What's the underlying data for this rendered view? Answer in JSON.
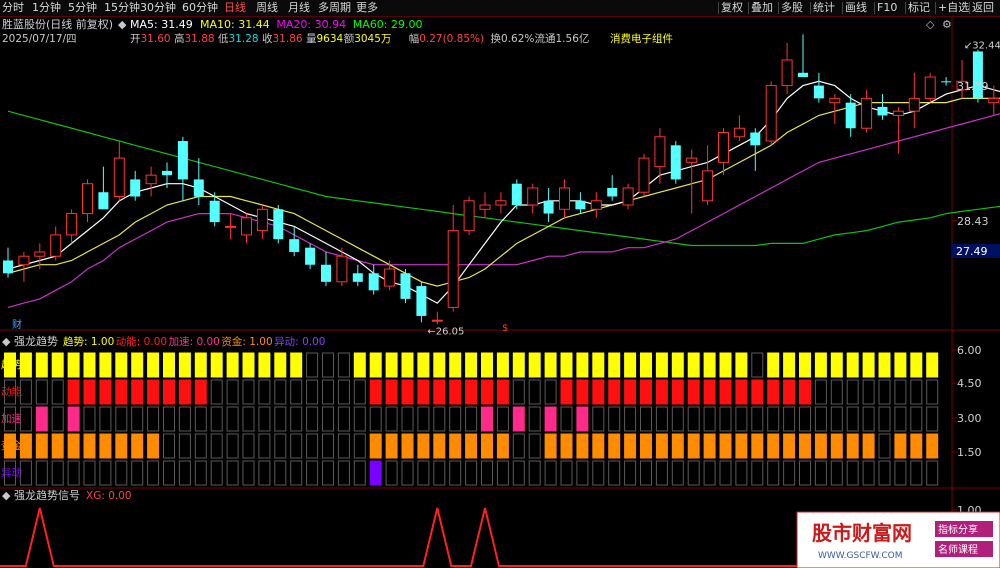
{
  "toolbar": {
    "left": [
      {
        "key": "fenshi",
        "label": "分时",
        "active": false
      },
      {
        "key": "1min",
        "label": "1分钟",
        "active": false
      },
      {
        "key": "5min",
        "label": "5分钟",
        "active": false
      },
      {
        "key": "15min",
        "label": "15分钟",
        "active": false
      },
      {
        "key": "30min",
        "label": "30分钟",
        "active": false
      },
      {
        "key": "60min",
        "label": "60分钟",
        "active": false
      },
      {
        "key": "daily",
        "label": "日线",
        "active": true
      },
      {
        "key": "weekly",
        "label": "周线",
        "active": false
      },
      {
        "key": "monthly",
        "label": "月线",
        "active": false
      },
      {
        "key": "multi",
        "label": "多周期",
        "active": false
      },
      {
        "key": "more",
        "label": "更多",
        "active": false
      }
    ],
    "right": [
      {
        "key": "fuquan",
        "label": "复权"
      },
      {
        "key": "diejia",
        "label": "叠加"
      },
      {
        "key": "duogu",
        "label": "多股"
      },
      {
        "key": "tongji",
        "label": "统计"
      },
      {
        "key": "huaxian",
        "label": "画线"
      },
      {
        "key": "f10",
        "label": "F10"
      },
      {
        "key": "biaoji",
        "label": "标记"
      },
      {
        "key": "zixuan",
        "label": "+自选"
      },
      {
        "key": "fanhui",
        "label": "返回"
      }
    ]
  },
  "header": {
    "stock": "胜蓝股份(日线 前复权)",
    "ma": [
      {
        "label": "MA5: 31.49",
        "color": "#ffffff"
      },
      {
        "label": "MA10: 31.44",
        "color": "#ffff00"
      },
      {
        "label": "MA20: 30.94",
        "color": "#ff00ff"
      },
      {
        "label": "MA60: 29.00",
        "color": "#00ff00"
      }
    ],
    "info": [
      {
        "text": "2025/07/17/四",
        "color": "#c8c8c8"
      },
      {
        "text": "开",
        "color": "#c8c8c8"
      },
      {
        "text": "31.60",
        "color": "#ff4040"
      },
      {
        "text": "高",
        "color": "#c8c8c8"
      },
      {
        "text": "31.88",
        "color": "#ff4040"
      },
      {
        "text": "低",
        "color": "#c8c8c8"
      },
      {
        "text": "31.28",
        "color": "#00e0e0"
      },
      {
        "text": "收",
        "color": "#c8c8c8"
      },
      {
        "text": "31.86",
        "color": "#ff4040"
      },
      {
        "text": "量",
        "color": "#c8c8c8"
      },
      {
        "text": "9634",
        "color": "#ffff00"
      },
      {
        "text": "额",
        "color": "#c8c8c8"
      },
      {
        "text": "3045万",
        "color": "#ffff00"
      },
      {
        "text": "幅",
        "color": "#c8c8c8"
      },
      {
        "text": "0.27(0.85%)",
        "color": "#ff4040"
      },
      {
        "text": "换",
        "color": "#c8c8c8"
      },
      {
        "text": "0.62%",
        "color": "#c8c8c8"
      },
      {
        "text": "流通",
        "color": "#c8c8c8"
      },
      {
        "text": "1.56亿",
        "color": "#c8c8c8"
      },
      {
        "text": "消费电子组件",
        "color": "#ffff00"
      }
    ]
  },
  "price_axis": {
    "ticks": [
      "31.59",
      "28.43"
    ],
    "current": "27.49",
    "high_mark": "32.44",
    "low_mark": "26.05",
    "cai_label": "财",
    "s_label": "$"
  },
  "chart_data": {
    "type": "candlestick",
    "candles": [
      {
        "o": 27.5,
        "h": 27.8,
        "l": 27.1,
        "c": 27.2,
        "color": "cyan"
      },
      {
        "o": 27.4,
        "h": 27.7,
        "l": 27.0,
        "c": 27.6,
        "color": "red"
      },
      {
        "o": 27.6,
        "h": 27.9,
        "l": 27.3,
        "c": 27.7,
        "color": "red"
      },
      {
        "o": 27.6,
        "h": 28.3,
        "l": 27.5,
        "c": 28.1,
        "color": "red"
      },
      {
        "o": 28.1,
        "h": 28.7,
        "l": 27.9,
        "c": 28.6,
        "color": "red"
      },
      {
        "o": 28.6,
        "h": 29.4,
        "l": 28.4,
        "c": 29.3,
        "color": "red"
      },
      {
        "o": 29.1,
        "h": 29.7,
        "l": 28.7,
        "c": 28.7,
        "color": "cyan"
      },
      {
        "o": 29.0,
        "h": 30.3,
        "l": 28.9,
        "c": 29.9,
        "color": "red"
      },
      {
        "o": 29.4,
        "h": 29.6,
        "l": 28.9,
        "c": 29.0,
        "color": "cyan"
      },
      {
        "o": 29.3,
        "h": 29.7,
        "l": 29.0,
        "c": 29.5,
        "color": "red"
      },
      {
        "o": 29.6,
        "h": 29.8,
        "l": 29.2,
        "c": 29.5,
        "color": "cyan"
      },
      {
        "o": 30.3,
        "h": 30.4,
        "l": 28.9,
        "c": 29.4,
        "color": "cyan"
      },
      {
        "o": 29.4,
        "h": 29.9,
        "l": 28.8,
        "c": 29.0,
        "color": "cyan"
      },
      {
        "o": 28.9,
        "h": 29.1,
        "l": 28.3,
        "c": 28.4,
        "color": "cyan"
      },
      {
        "o": 28.3,
        "h": 28.6,
        "l": 28.0,
        "c": 28.3,
        "color": "red"
      },
      {
        "o": 28.1,
        "h": 28.6,
        "l": 27.9,
        "c": 28.5,
        "color": "red"
      },
      {
        "o": 28.2,
        "h": 28.8,
        "l": 28.0,
        "c": 28.7,
        "color": "red"
      },
      {
        "o": 28.7,
        "h": 28.8,
        "l": 27.9,
        "c": 28.0,
        "color": "cyan"
      },
      {
        "o": 28.0,
        "h": 28.3,
        "l": 27.6,
        "c": 27.7,
        "color": "cyan"
      },
      {
        "o": 27.8,
        "h": 27.9,
        "l": 27.3,
        "c": 27.4,
        "color": "cyan"
      },
      {
        "o": 27.4,
        "h": 27.7,
        "l": 26.9,
        "c": 27.0,
        "color": "cyan"
      },
      {
        "o": 27.0,
        "h": 27.8,
        "l": 26.9,
        "c": 27.6,
        "color": "red"
      },
      {
        "o": 27.2,
        "h": 27.4,
        "l": 26.9,
        "c": 27.0,
        "color": "cyan"
      },
      {
        "o": 27.2,
        "h": 27.4,
        "l": 26.7,
        "c": 26.8,
        "color": "cyan"
      },
      {
        "o": 26.9,
        "h": 27.5,
        "l": 26.8,
        "c": 27.3,
        "color": "red"
      },
      {
        "o": 27.2,
        "h": 27.3,
        "l": 26.5,
        "c": 26.6,
        "color": "cyan"
      },
      {
        "o": 26.9,
        "h": 27.0,
        "l": 26.05,
        "c": 26.2,
        "color": "cyan"
      },
      {
        "o": 26.1,
        "h": 26.3,
        "l": 26.0,
        "c": 26.1,
        "color": "red"
      },
      {
        "o": 26.4,
        "h": 28.8,
        "l": 26.3,
        "c": 28.2,
        "color": "red"
      },
      {
        "o": 28.2,
        "h": 29.0,
        "l": 28.1,
        "c": 28.9,
        "color": "red"
      },
      {
        "o": 28.7,
        "h": 29.1,
        "l": 28.5,
        "c": 28.8,
        "color": "red"
      },
      {
        "o": 28.8,
        "h": 29.1,
        "l": 28.6,
        "c": 28.9,
        "color": "red"
      },
      {
        "o": 29.3,
        "h": 29.4,
        "l": 28.7,
        "c": 28.8,
        "color": "cyan"
      },
      {
        "o": 28.8,
        "h": 29.3,
        "l": 28.6,
        "c": 29.2,
        "color": "red"
      },
      {
        "o": 28.9,
        "h": 29.2,
        "l": 28.4,
        "c": 28.6,
        "color": "cyan"
      },
      {
        "o": 28.7,
        "h": 29.4,
        "l": 28.5,
        "c": 29.2,
        "color": "red"
      },
      {
        "o": 28.9,
        "h": 29.1,
        "l": 28.6,
        "c": 28.7,
        "color": "cyan"
      },
      {
        "o": 28.7,
        "h": 29.1,
        "l": 28.5,
        "c": 28.9,
        "color": "red"
      },
      {
        "o": 29.2,
        "h": 29.5,
        "l": 28.9,
        "c": 29.0,
        "color": "cyan"
      },
      {
        "o": 28.8,
        "h": 29.3,
        "l": 28.7,
        "c": 29.2,
        "color": "red"
      },
      {
        "o": 29.1,
        "h": 30.0,
        "l": 29.0,
        "c": 29.9,
        "color": "red"
      },
      {
        "o": 29.7,
        "h": 30.6,
        "l": 29.3,
        "c": 30.4,
        "color": "red"
      },
      {
        "o": 30.2,
        "h": 30.3,
        "l": 29.3,
        "c": 29.4,
        "color": "cyan"
      },
      {
        "o": 29.8,
        "h": 30.1,
        "l": 28.6,
        "c": 29.9,
        "color": "red"
      },
      {
        "o": 28.9,
        "h": 30.2,
        "l": 28.8,
        "c": 29.6,
        "color": "red"
      },
      {
        "o": 29.8,
        "h": 30.6,
        "l": 29.5,
        "c": 30.5,
        "color": "red"
      },
      {
        "o": 30.4,
        "h": 30.9,
        "l": 30.3,
        "c": 30.6,
        "color": "red"
      },
      {
        "o": 30.5,
        "h": 30.6,
        "l": 29.6,
        "c": 30.2,
        "color": "cyan"
      },
      {
        "o": 30.3,
        "h": 31.7,
        "l": 30.2,
        "c": 31.6,
        "color": "red"
      },
      {
        "o": 31.6,
        "h": 32.6,
        "l": 31.4,
        "c": 32.2,
        "color": "red"
      },
      {
        "o": 31.9,
        "h": 32.8,
        "l": 31.8,
        "c": 31.8,
        "color": "cyan"
      },
      {
        "o": 31.6,
        "h": 31.9,
        "l": 31.2,
        "c": 31.3,
        "color": "cyan"
      },
      {
        "o": 31.2,
        "h": 31.4,
        "l": 30.7,
        "c": 31.3,
        "color": "red"
      },
      {
        "o": 31.2,
        "h": 31.4,
        "l": 30.4,
        "c": 30.6,
        "color": "cyan"
      },
      {
        "o": 30.6,
        "h": 31.5,
        "l": 30.5,
        "c": 31.3,
        "color": "red"
      },
      {
        "o": 31.1,
        "h": 31.4,
        "l": 30.8,
        "c": 30.9,
        "color": "cyan"
      },
      {
        "o": 30.9,
        "h": 31.1,
        "l": 30.0,
        "c": 31.0,
        "color": "red"
      },
      {
        "o": 31.0,
        "h": 31.9,
        "l": 30.6,
        "c": 31.3,
        "color": "red"
      },
      {
        "o": 31.3,
        "h": 31.9,
        "l": 31.2,
        "c": 31.8,
        "color": "red"
      },
      {
        "o": 31.7,
        "h": 31.8,
        "l": 31.6,
        "c": 31.7,
        "color": "cyan"
      },
      {
        "o": 31.5,
        "h": 32.2,
        "l": 31.3,
        "c": 31.7,
        "color": "red"
      },
      {
        "o": 32.4,
        "h": 32.44,
        "l": 31.2,
        "c": 31.3,
        "color": "cyan"
      },
      {
        "o": 31.2,
        "h": 31.6,
        "l": 30.9,
        "c": 31.3,
        "color": "red"
      },
      {
        "o": 31.3,
        "h": 31.5,
        "l": 30.9,
        "c": 31.1,
        "color": "cyan"
      },
      {
        "o": 31.1,
        "h": 31.9,
        "l": 31.0,
        "c": 31.5,
        "color": "red"
      },
      {
        "o": 31.6,
        "h": 31.9,
        "l": 31.2,
        "c": 31.3,
        "color": "cyan"
      },
      {
        "o": 31.6,
        "h": 31.88,
        "l": 31.28,
        "c": 31.86,
        "color": "red"
      }
    ],
    "ma5": [
      27.3,
      27.4,
      27.5,
      27.6,
      27.9,
      28.2,
      28.5,
      28.9,
      29.1,
      29.2,
      29.3,
      29.3,
      29.2,
      29.0,
      28.8,
      28.6,
      28.5,
      28.4,
      28.3,
      28.1,
      27.9,
      27.7,
      27.5,
      27.2,
      27.0,
      26.9,
      26.7,
      26.5,
      26.9,
      27.4,
      27.9,
      28.4,
      28.8,
      28.8,
      28.9,
      28.9,
      28.9,
      28.8,
      28.8,
      28.9,
      29.2,
      29.5,
      29.6,
      29.7,
      29.8,
      30.0,
      30.2,
      30.4,
      30.8,
      31.3,
      31.6,
      31.7,
      31.6,
      31.3,
      31.1,
      31.0,
      30.9,
      31.0,
      31.2,
      31.4,
      31.5,
      31.6,
      31.5,
      31.4,
      31.4,
      31.4,
      31.5
    ],
    "ma10": [
      27.2,
      27.3,
      27.4,
      27.4,
      27.5,
      27.7,
      27.9,
      28.1,
      28.4,
      28.6,
      28.8,
      28.9,
      29.0,
      29.0,
      29.0,
      28.9,
      28.8,
      28.7,
      28.6,
      28.4,
      28.2,
      28.0,
      27.8,
      27.6,
      27.4,
      27.2,
      27.0,
      26.9,
      27.0,
      27.1,
      27.3,
      27.6,
      27.9,
      28.1,
      28.3,
      28.5,
      28.6,
      28.7,
      28.8,
      28.9,
      29.0,
      29.1,
      29.2,
      29.3,
      29.4,
      29.6,
      29.8,
      30.0,
      30.2,
      30.5,
      30.7,
      30.9,
      31.0,
      31.1,
      31.2,
      31.2,
      31.2,
      31.2,
      31.2,
      31.2,
      31.3,
      31.3,
      31.3,
      31.3,
      31.4,
      31.4,
      31.4
    ],
    "ma20": [
      26.4,
      26.5,
      26.6,
      26.8,
      27.0,
      27.3,
      27.5,
      27.8,
      28.0,
      28.2,
      28.4,
      28.5,
      28.6,
      28.6,
      28.6,
      28.5,
      28.4,
      28.3,
      28.1,
      27.9,
      27.7,
      27.6,
      27.5,
      27.4,
      27.4,
      27.4,
      27.4,
      27.4,
      27.4,
      27.4,
      27.4,
      27.4,
      27.4,
      27.5,
      27.6,
      27.6,
      27.7,
      27.7,
      27.7,
      27.8,
      27.8,
      27.9,
      28.0,
      28.2,
      28.4,
      28.6,
      28.8,
      29.0,
      29.2,
      29.4,
      29.6,
      29.8,
      29.9,
      30.0,
      30.1,
      30.2,
      30.3,
      30.4,
      30.5,
      30.6,
      30.7,
      30.8,
      30.9,
      31.0,
      31.1,
      31.2,
      31.35
    ],
    "ma60": [
      31.0,
      30.9,
      30.8,
      30.7,
      30.6,
      30.5,
      30.4,
      30.3,
      30.2,
      30.1,
      30.0,
      29.9,
      29.8,
      29.7,
      29.6,
      29.5,
      29.4,
      29.3,
      29.2,
      29.1,
      29.0,
      28.95,
      28.9,
      28.85,
      28.8,
      28.75,
      28.7,
      28.65,
      28.6,
      28.55,
      28.5,
      28.45,
      28.4,
      28.35,
      28.3,
      28.25,
      28.2,
      28.15,
      28.1,
      28.05,
      28.0,
      27.95,
      27.9,
      27.85,
      27.85,
      27.85,
      27.85,
      27.85,
      27.9,
      27.9,
      27.9,
      28.0,
      28.1,
      28.15,
      28.2,
      28.3,
      28.4,
      28.45,
      28.5,
      28.6,
      28.65,
      28.7,
      28.75,
      28.8,
      28.9,
      29.0,
      29.1
    ]
  },
  "indicator": {
    "title": "强龙趋势",
    "values": [
      {
        "text": "趋势: 1.00",
        "color": "#ffff00"
      },
      {
        "text": "动能: 0.00",
        "color": "#ff2020"
      },
      {
        "text": "加速: 0.00",
        "color": "#ff3090"
      },
      {
        "text": "资金: 1.00",
        "color": "#ff8c00"
      },
      {
        "text": "异动: 0.00",
        "color": "#8040ff"
      }
    ],
    "rows": [
      {
        "label": "趋势",
        "color": "#ffff00",
        "bits": "1111111111111111111000111111111111111111111111101111111111111111111"
      },
      {
        "label": "动能",
        "color": "#ff1010",
        "bits": "0000111111111000000000011111111100011111111111111110000000001010000"
      },
      {
        "label": "加速",
        "color": "#ff2a8a",
        "bits": "0010100000000000000000000000001010101000000000000000000000000000000"
      },
      {
        "label": "资金",
        "color": "#ff8c00",
        "bits": "1111111111000000000000011111111100111111111111111111111011111111111"
      },
      {
        "label": "异动",
        "color": "#7b00ff",
        "bits": "0000000000000000000000010000000000000000000000000000000000000000000"
      }
    ],
    "axis": [
      "6.00",
      "4.50",
      "3.00",
      "1.50"
    ]
  },
  "signal": {
    "title": "强龙趋势信号",
    "value": "XG: 0.00",
    "axis": "1.00",
    "spikes": [
      2,
      27,
      30
    ]
  },
  "watermark": {
    "title": "股市财富网",
    "url": "WWW.GSCFW.COM",
    "tag1": "指标分享",
    "tag2": "名师课程"
  }
}
